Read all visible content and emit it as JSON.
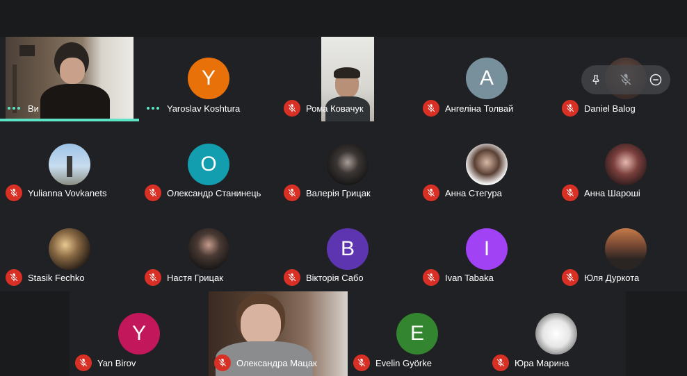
{
  "colors": {
    "mic_off": "#d93025",
    "speaking": "#5ee4c4",
    "background": "#202124"
  },
  "participants": [
    {
      "name": "Ви",
      "status": "speaking",
      "avatar": "video-self"
    },
    {
      "name": "Yaroslav Koshtura",
      "status": "speaking",
      "avatar": "letter",
      "letter": "Y",
      "color": "#e8710a"
    },
    {
      "name": "Рома Ковачук",
      "status": "muted",
      "avatar": "video"
    },
    {
      "name": "Ангеліна Толвай",
      "status": "muted",
      "avatar": "letter",
      "letter": "A",
      "color": "#78909c"
    },
    {
      "name": "Daniel Balog",
      "status": "muted",
      "avatar": "photo"
    },
    {
      "name": "Yulianna Vovkanets",
      "status": "muted",
      "avatar": "photo"
    },
    {
      "name": "Олександр Станинець",
      "status": "muted",
      "avatar": "letter",
      "letter": "O",
      "color": "#129eaf"
    },
    {
      "name": "Валерія Грицак",
      "status": "muted",
      "avatar": "photo"
    },
    {
      "name": "Анна Стегура",
      "status": "muted",
      "avatar": "photo"
    },
    {
      "name": "Анна Шароші",
      "status": "muted",
      "avatar": "photo"
    },
    {
      "name": "Stasik Fechko",
      "status": "muted",
      "avatar": "photo"
    },
    {
      "name": "Настя Грицак",
      "status": "muted",
      "avatar": "photo"
    },
    {
      "name": "Вікторія Сабо",
      "status": "muted",
      "avatar": "letter",
      "letter": "B",
      "color": "#5e35b1"
    },
    {
      "name": "Ivan Tabaka",
      "status": "muted",
      "avatar": "letter",
      "letter": "I",
      "color": "#a142f4"
    },
    {
      "name": "Юля Дуркота",
      "status": "muted",
      "avatar": "photo"
    },
    {
      "name": "Yan Birov",
      "status": "muted",
      "avatar": "letter",
      "letter": "Y",
      "color": "#c2185b"
    },
    {
      "name": "Олександра Мацак",
      "status": "muted",
      "avatar": "video"
    },
    {
      "name": "Evelin Györke",
      "status": "muted",
      "avatar": "letter",
      "letter": "E",
      "color": "#33862f"
    },
    {
      "name": "Юра Марина",
      "status": "muted",
      "avatar": "photo"
    }
  ],
  "tile_controls": {
    "icons": [
      "pin-icon",
      "mic-off-icon",
      "remove-icon"
    ]
  }
}
